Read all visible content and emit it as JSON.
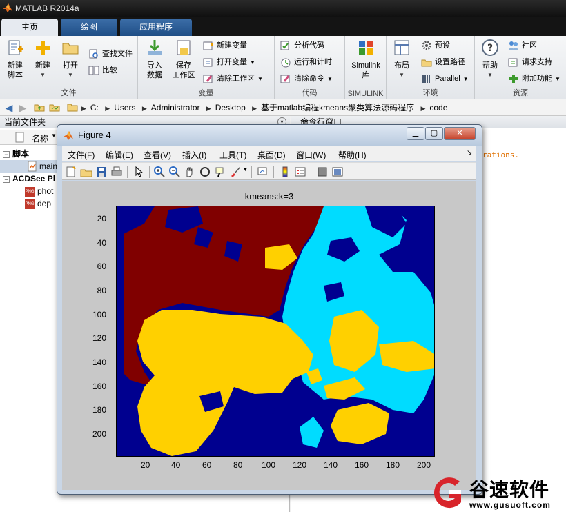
{
  "app": {
    "title": "MATLAB R2014a"
  },
  "tabs": [
    {
      "label": "主页"
    },
    {
      "label": "绘图"
    },
    {
      "label": "应用程序"
    }
  ],
  "ribbon": {
    "file": {
      "group": "文件",
      "new_script": "新建\n脚本",
      "new": "新建",
      "open": "打开",
      "find_files": "查找文件",
      "compare": "比较"
    },
    "variable": {
      "group": "变量",
      "import": "导入\n数据",
      "save_ws": "保存\n工作区",
      "new_var": "新建变量",
      "open_var": "打开变量",
      "clear_ws": "清除工作区"
    },
    "code": {
      "group": "代码",
      "analyze": "分析代码",
      "run_time": "运行和计时",
      "clear_cmd": "清除命令"
    },
    "simulink": {
      "group": "SIMULINK",
      "lib": "Simulink\n库"
    },
    "env": {
      "group": "环境",
      "layout": "布局",
      "prefs": "预设",
      "set_path": "设置路径",
      "parallel": "Parallel"
    },
    "resources": {
      "group": "资源",
      "help": "帮助",
      "community": "社区",
      "support": "请求支持",
      "addons": "附加功能"
    }
  },
  "address": {
    "path": [
      "C:",
      "Users",
      "Administrator",
      "Desktop",
      "基于matlab编程kmeans聚类算法源码程序",
      "code"
    ]
  },
  "left_panel": {
    "title": "当前文件夹",
    "col_name": "名称",
    "group1": "脚本",
    "file1": "main",
    "group2": "ACDSee Pl",
    "file2": "phot",
    "file3": "dep"
  },
  "right_panel": {
    "title": "命令行窗口",
    "text": "rations."
  },
  "figure": {
    "title": "Figure 4",
    "menu": [
      "文件(F)",
      "编辑(E)",
      "查看(V)",
      "插入(I)",
      "工具(T)",
      "桌面(D)",
      "窗口(W)",
      "帮助(H)"
    ],
    "plot_title": "kmeans:k=3",
    "x_ticks": [
      "20",
      "40",
      "60",
      "80",
      "100",
      "120",
      "140",
      "160",
      "180",
      "200"
    ],
    "y_ticks": [
      "20",
      "40",
      "60",
      "80",
      "100",
      "120",
      "140",
      "160",
      "180",
      "200"
    ],
    "colors": {
      "background": "#00008f",
      "cluster_dark_red": "#800000",
      "cluster_cyan": "#00dcff",
      "cluster_yellow": "#ffd000"
    }
  },
  "watermark": {
    "name": "谷速软件",
    "url": "www.gusuoft.com"
  }
}
